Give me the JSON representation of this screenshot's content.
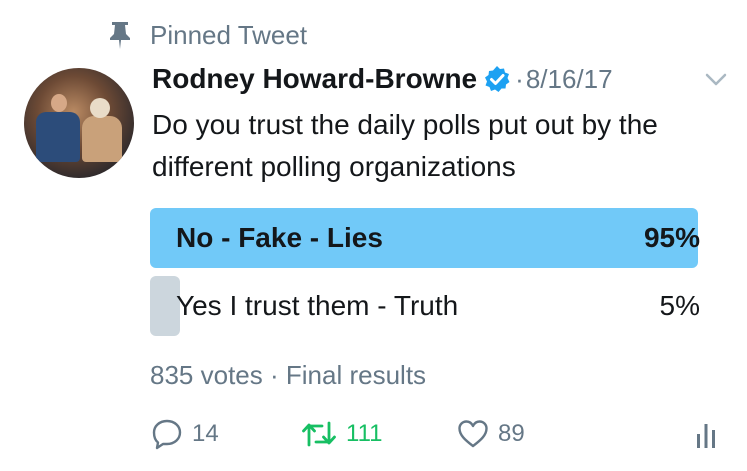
{
  "pinned": {
    "label": "Pinned Tweet",
    "icon": "pin-icon"
  },
  "tweet": {
    "author_name": "Rodney Howard-Browne",
    "separator": "·",
    "date": "8/16/17",
    "text": "Do you trust the daily polls put out by the different polling organizations"
  },
  "poll": {
    "options": [
      {
        "label": "No - Fake - Lies",
        "percent": "95%",
        "fraction": 0.95,
        "winner": true
      },
      {
        "label": "Yes I trust them - Truth",
        "percent": "5%",
        "fraction": 0.05,
        "winner": false
      }
    ],
    "votes": "835 votes",
    "meta_separator": "·",
    "status": "Final results"
  },
  "actions": {
    "replies": "14",
    "retweets": "111",
    "likes": "89"
  },
  "colors": {
    "winner_bar": "#71c9f8",
    "loser_bar": "#ccd6dd",
    "verified": "#1da1f2",
    "retweet_green": "#17bf63",
    "muted": "#657786"
  }
}
